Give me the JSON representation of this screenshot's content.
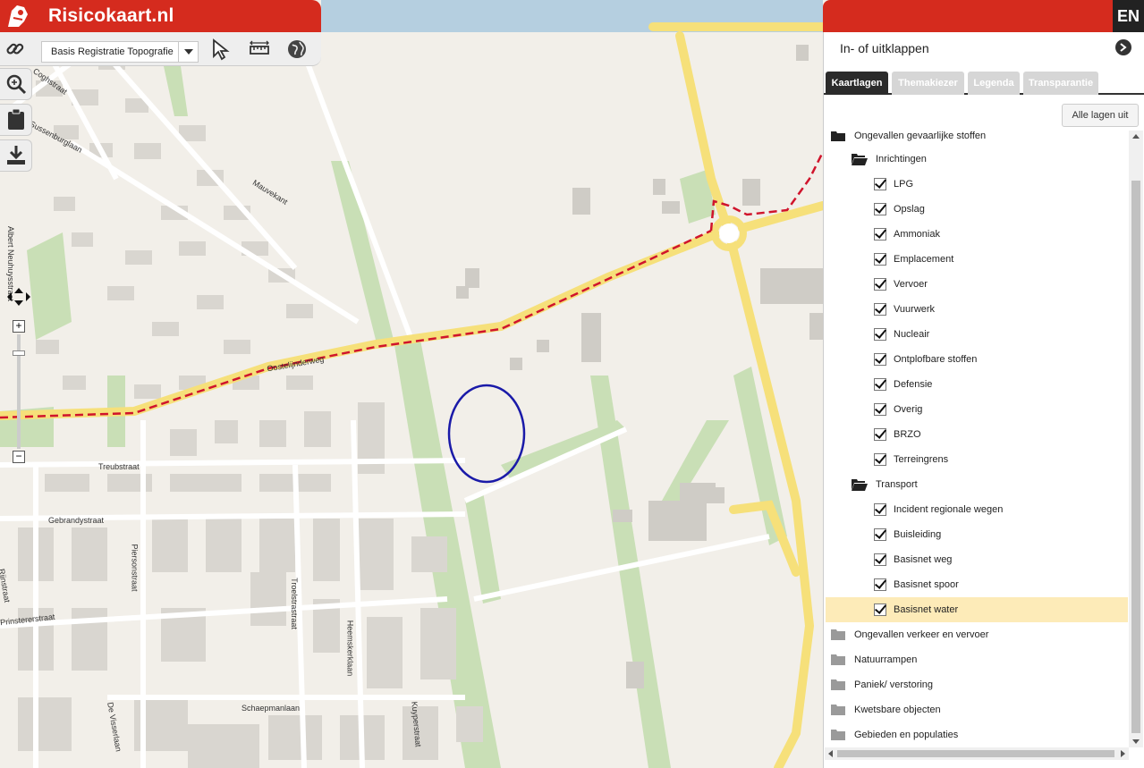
{
  "app": {
    "title": "Risicokaart.nl",
    "language": "EN"
  },
  "toolbar": {
    "layer_select": "Basis Registratie Topografie",
    "tools": [
      "link-icon",
      "search-zoom-icon",
      "clipboard-icon",
      "download-icon",
      "select-arrow-icon",
      "measure-icon",
      "globe-icon"
    ]
  },
  "map": {
    "streets": [
      "Coghstraat",
      "Sussenburglaan",
      "Mauvekant",
      "Albert Neuhuysstraat",
      "Oostelijnderweg",
      "Treubstraat",
      "Gebrandystraat",
      "Piersonstraat",
      "Troelstrastraat",
      "Heemskerklaan",
      "Prinstererstraat",
      "Schaepmanlaan",
      "De Visserlaan",
      "Kuyperstraat",
      "Rijnstraat"
    ]
  },
  "panel": {
    "collapse_label": "In- of uitklappen",
    "tabs": [
      "Kaartlagen",
      "Themakiezer",
      "Legenda",
      "Transparantie"
    ],
    "active_tab": "Kaartlagen",
    "all_off_button": "Alle lagen uit",
    "top_group": "Ongevallen gevaarlijke stoffen",
    "inrichtingen": {
      "label": "Inrichtingen",
      "items": [
        "LPG",
        "Opslag",
        "Ammoniak",
        "Emplacement",
        "Vervoer",
        "Vuurwerk",
        "Nucleair",
        "Ontplofbare stoffen",
        "Defensie",
        "Overig",
        "BRZO",
        "Terreingrens"
      ]
    },
    "transport": {
      "label": "Transport",
      "items": [
        "Incident regionale wegen",
        "Buisleiding",
        "Basisnet weg",
        "Basisnet spoor",
        "Basisnet water"
      ]
    },
    "highlighted": "Basisnet water",
    "groups": [
      "Ongevallen verkeer en vervoer",
      "Natuurrampen",
      "Paniek/ verstoring",
      "Kwetsbare objecten",
      "Gebieden en populaties"
    ]
  }
}
